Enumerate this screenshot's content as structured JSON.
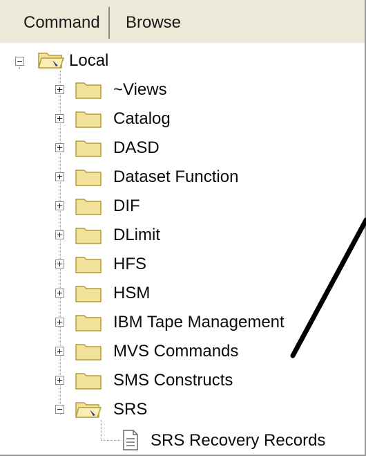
{
  "tabs": {
    "command": "Command",
    "browse": "Browse"
  },
  "tree": {
    "root": {
      "label": "Local",
      "expanded": true
    },
    "children": [
      {
        "label": "~Views",
        "expanded": false
      },
      {
        "label": "Catalog",
        "expanded": false
      },
      {
        "label": "DASD",
        "expanded": false
      },
      {
        "label": "Dataset Function",
        "expanded": false
      },
      {
        "label": "DIF",
        "expanded": false
      },
      {
        "label": "DLimit",
        "expanded": false
      },
      {
        "label": "HFS",
        "expanded": false
      },
      {
        "label": "HSM",
        "expanded": false
      },
      {
        "label": "IBM Tape Management",
        "expanded": false
      },
      {
        "label": "MVS Commands",
        "expanded": false
      },
      {
        "label": "SMS Constructs",
        "expanded": false
      },
      {
        "label": "SRS",
        "expanded": true
      }
    ],
    "leaf": {
      "label": "SRS Recovery Records"
    }
  },
  "icons": {
    "folder": "folder-icon",
    "folder_open": "folder-open-icon",
    "document": "document-icon",
    "expand": "plus-icon",
    "collapse": "minus-icon"
  },
  "colors": {
    "folder_fill": "#f2e29a",
    "folder_stroke": "#b69a3a",
    "tabbar": "#ece9d8",
    "annotation_arrow": "#000000"
  }
}
